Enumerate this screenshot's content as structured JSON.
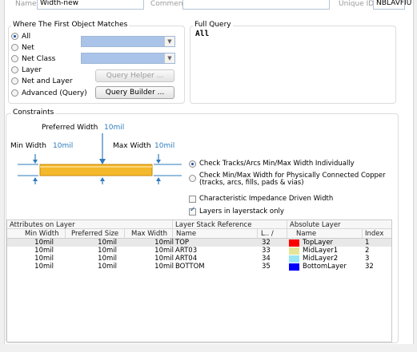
{
  "header": {
    "name_label": "Name",
    "name_value": "Width-new",
    "comment_label": "Comment",
    "comment_value": "",
    "uid_label": "Unique ID",
    "uid_value": "NBLAVFIU"
  },
  "match": {
    "title": "Where The First Object Matches",
    "options": [
      {
        "label": "All",
        "selected": true
      },
      {
        "label": "Net",
        "selected": false
      },
      {
        "label": "Net Class",
        "selected": false
      },
      {
        "label": "Layer",
        "selected": false
      },
      {
        "label": "Net and Layer",
        "selected": false
      },
      {
        "label": "Advanced (Query)",
        "selected": false
      }
    ],
    "query_helper": "Query Helper ...",
    "query_builder": "Query Builder ..."
  },
  "full_query": {
    "title": "Full Query",
    "text": "All"
  },
  "constraints": {
    "title": "Constraints",
    "preferred_label": "Preferred Width",
    "preferred_value": "10mil",
    "min_label": "Min Width",
    "min_value": "10mil",
    "max_label": "Max Width",
    "max_value": "10mil",
    "radio_individual": "Check Tracks/Arcs Min/Max Width Individually",
    "radio_connected_1": "Check Min/Max Width for Physically Connected Copper",
    "radio_connected_2": "(tracks, arcs, fills, pads & vias)",
    "chk_impedance": "Characteristic Impedance Driven Width",
    "chk_stack_only": "Layers in layerstack only",
    "chk_impedance_on": false,
    "chk_stack_only_on": true
  },
  "table": {
    "group_attributes": "Attributes on Layer",
    "group_stack": "Layer Stack Reference",
    "group_absolute": "Absolute Layer",
    "col_min": "Min Width",
    "col_pref": "Preferred Size",
    "col_max": "Max Width",
    "col_name": "Name",
    "col_sort": "L.. /",
    "col_abs_name": "Name",
    "col_index": "Index",
    "rows": [
      {
        "min": "10mil",
        "pref": "10mil",
        "max": "10mil",
        "name": "TOP",
        "l": "32",
        "abs_name": "TopLayer",
        "index": "1",
        "color": "#ff0000"
      },
      {
        "min": "10mil",
        "pref": "10mil",
        "max": "10mil",
        "name": "ART03",
        "l": "33",
        "abs_name": "MidLayer1",
        "index": "2",
        "color": "#e5e59a"
      },
      {
        "min": "10mil",
        "pref": "10mil",
        "max": "10mil",
        "name": "ART04",
        "l": "34",
        "abs_name": "MidLayer2",
        "index": "3",
        "color": "#99e5f5"
      },
      {
        "min": "10mil",
        "pref": "10mil",
        "max": "10mil",
        "name": "BOTTOM",
        "l": "35",
        "abs_name": "BottomLayer",
        "index": "32",
        "color": "#0000ff"
      }
    ]
  }
}
